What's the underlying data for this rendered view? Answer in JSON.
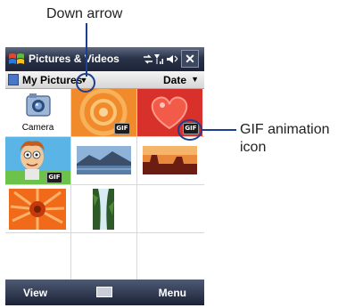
{
  "callouts": {
    "down_arrow": "Down arrow",
    "gif_line1": "GIF animation",
    "gif_line2": "icon"
  },
  "titlebar": {
    "title": "Pictures & Videos",
    "close": "✕"
  },
  "subbar": {
    "folder": "My Pictures",
    "sort": "Date"
  },
  "grid": {
    "camera_label": "Camera",
    "gif_badge": "GIF"
  },
  "softkeys": {
    "left": "View",
    "right": "Menu"
  },
  "colors": {
    "accent": "#1d3f8f",
    "titlebar": "#2a3349"
  }
}
